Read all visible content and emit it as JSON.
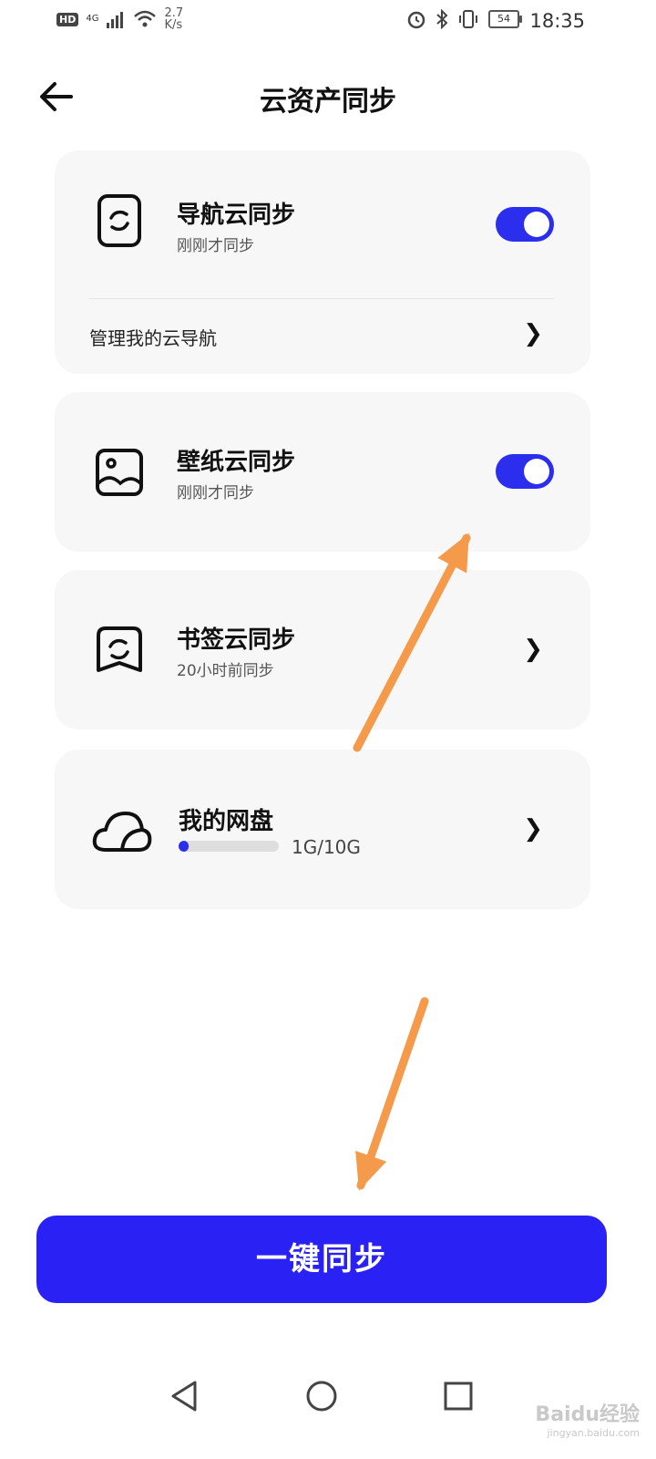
{
  "status_bar": {
    "hd": "HD",
    "network": "4G",
    "speed_value": "2.7",
    "speed_unit": "K/s",
    "battery": "54",
    "time": "18:35"
  },
  "header": {
    "title": "云资产同步"
  },
  "cards": {
    "nav": {
      "title": "导航云同步",
      "subtitle": "刚刚才同步",
      "toggle_on": true,
      "manage_label": "管理我的云导航"
    },
    "wallpaper": {
      "title": "壁纸云同步",
      "subtitle": "刚刚才同步",
      "toggle_on": true
    },
    "bookmark": {
      "title": "书签云同步",
      "subtitle": "20小时前同步"
    },
    "disk": {
      "title": "我的网盘",
      "usage": "1G/10G",
      "usage_fraction": 0.1
    }
  },
  "sync_button": {
    "label": "一键同步"
  },
  "watermark": {
    "brand": "Baidu经验",
    "url": "jingyan.baidu.com"
  },
  "colors": {
    "accent": "#2b2eec",
    "button": "#2a22f5",
    "annotation_arrow": "#f59a4a",
    "card_bg": "#f7f7f7"
  }
}
